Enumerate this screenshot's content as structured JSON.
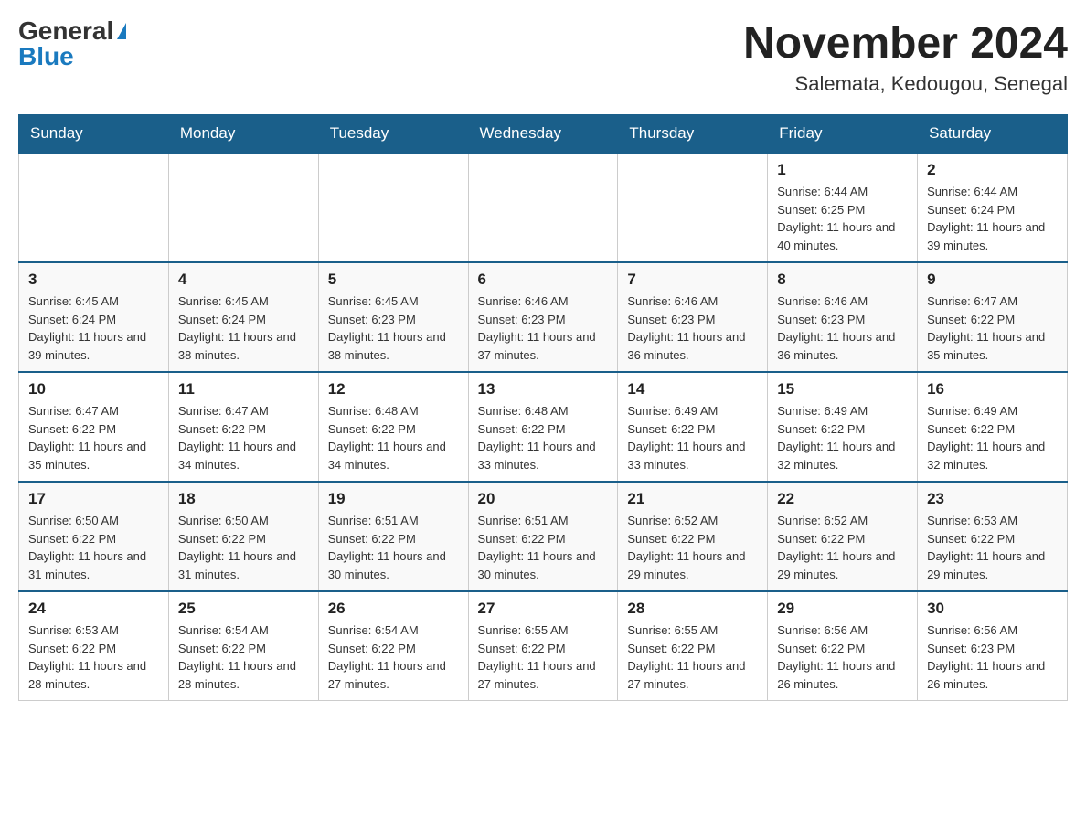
{
  "logo": {
    "general": "General",
    "blue": "Blue"
  },
  "header": {
    "month": "November 2024",
    "location": "Salemata, Kedougou, Senegal"
  },
  "weekdays": [
    "Sunday",
    "Monday",
    "Tuesday",
    "Wednesday",
    "Thursday",
    "Friday",
    "Saturday"
  ],
  "weeks": [
    [
      {
        "day": "",
        "info": ""
      },
      {
        "day": "",
        "info": ""
      },
      {
        "day": "",
        "info": ""
      },
      {
        "day": "",
        "info": ""
      },
      {
        "day": "",
        "info": ""
      },
      {
        "day": "1",
        "info": "Sunrise: 6:44 AM\nSunset: 6:25 PM\nDaylight: 11 hours and 40 minutes."
      },
      {
        "day": "2",
        "info": "Sunrise: 6:44 AM\nSunset: 6:24 PM\nDaylight: 11 hours and 39 minutes."
      }
    ],
    [
      {
        "day": "3",
        "info": "Sunrise: 6:45 AM\nSunset: 6:24 PM\nDaylight: 11 hours and 39 minutes."
      },
      {
        "day": "4",
        "info": "Sunrise: 6:45 AM\nSunset: 6:24 PM\nDaylight: 11 hours and 38 minutes."
      },
      {
        "day": "5",
        "info": "Sunrise: 6:45 AM\nSunset: 6:23 PM\nDaylight: 11 hours and 38 minutes."
      },
      {
        "day": "6",
        "info": "Sunrise: 6:46 AM\nSunset: 6:23 PM\nDaylight: 11 hours and 37 minutes."
      },
      {
        "day": "7",
        "info": "Sunrise: 6:46 AM\nSunset: 6:23 PM\nDaylight: 11 hours and 36 minutes."
      },
      {
        "day": "8",
        "info": "Sunrise: 6:46 AM\nSunset: 6:23 PM\nDaylight: 11 hours and 36 minutes."
      },
      {
        "day": "9",
        "info": "Sunrise: 6:47 AM\nSunset: 6:22 PM\nDaylight: 11 hours and 35 minutes."
      }
    ],
    [
      {
        "day": "10",
        "info": "Sunrise: 6:47 AM\nSunset: 6:22 PM\nDaylight: 11 hours and 35 minutes."
      },
      {
        "day": "11",
        "info": "Sunrise: 6:47 AM\nSunset: 6:22 PM\nDaylight: 11 hours and 34 minutes."
      },
      {
        "day": "12",
        "info": "Sunrise: 6:48 AM\nSunset: 6:22 PM\nDaylight: 11 hours and 34 minutes."
      },
      {
        "day": "13",
        "info": "Sunrise: 6:48 AM\nSunset: 6:22 PM\nDaylight: 11 hours and 33 minutes."
      },
      {
        "day": "14",
        "info": "Sunrise: 6:49 AM\nSunset: 6:22 PM\nDaylight: 11 hours and 33 minutes."
      },
      {
        "day": "15",
        "info": "Sunrise: 6:49 AM\nSunset: 6:22 PM\nDaylight: 11 hours and 32 minutes."
      },
      {
        "day": "16",
        "info": "Sunrise: 6:49 AM\nSunset: 6:22 PM\nDaylight: 11 hours and 32 minutes."
      }
    ],
    [
      {
        "day": "17",
        "info": "Sunrise: 6:50 AM\nSunset: 6:22 PM\nDaylight: 11 hours and 31 minutes."
      },
      {
        "day": "18",
        "info": "Sunrise: 6:50 AM\nSunset: 6:22 PM\nDaylight: 11 hours and 31 minutes."
      },
      {
        "day": "19",
        "info": "Sunrise: 6:51 AM\nSunset: 6:22 PM\nDaylight: 11 hours and 30 minutes."
      },
      {
        "day": "20",
        "info": "Sunrise: 6:51 AM\nSunset: 6:22 PM\nDaylight: 11 hours and 30 minutes."
      },
      {
        "day": "21",
        "info": "Sunrise: 6:52 AM\nSunset: 6:22 PM\nDaylight: 11 hours and 29 minutes."
      },
      {
        "day": "22",
        "info": "Sunrise: 6:52 AM\nSunset: 6:22 PM\nDaylight: 11 hours and 29 minutes."
      },
      {
        "day": "23",
        "info": "Sunrise: 6:53 AM\nSunset: 6:22 PM\nDaylight: 11 hours and 29 minutes."
      }
    ],
    [
      {
        "day": "24",
        "info": "Sunrise: 6:53 AM\nSunset: 6:22 PM\nDaylight: 11 hours and 28 minutes."
      },
      {
        "day": "25",
        "info": "Sunrise: 6:54 AM\nSunset: 6:22 PM\nDaylight: 11 hours and 28 minutes."
      },
      {
        "day": "26",
        "info": "Sunrise: 6:54 AM\nSunset: 6:22 PM\nDaylight: 11 hours and 27 minutes."
      },
      {
        "day": "27",
        "info": "Sunrise: 6:55 AM\nSunset: 6:22 PM\nDaylight: 11 hours and 27 minutes."
      },
      {
        "day": "28",
        "info": "Sunrise: 6:55 AM\nSunset: 6:22 PM\nDaylight: 11 hours and 27 minutes."
      },
      {
        "day": "29",
        "info": "Sunrise: 6:56 AM\nSunset: 6:22 PM\nDaylight: 11 hours and 26 minutes."
      },
      {
        "day": "30",
        "info": "Sunrise: 6:56 AM\nSunset: 6:23 PM\nDaylight: 11 hours and 26 minutes."
      }
    ]
  ]
}
